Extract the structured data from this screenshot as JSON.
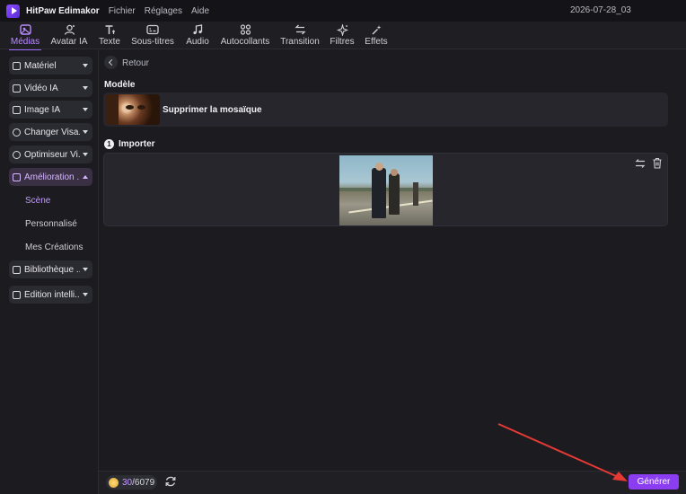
{
  "titlebar": {
    "app_name": "HitPaw Edimakor",
    "menu": [
      "Fichier",
      "Réglages",
      "Aide"
    ],
    "project_name": "2026-07-28_03"
  },
  "toolbar": {
    "tools": [
      {
        "label": "Médias",
        "icon": "media-icon",
        "active": true
      },
      {
        "label": "Avatar IA",
        "icon": "avatar-icon"
      },
      {
        "label": "Texte",
        "icon": "text-icon"
      },
      {
        "label": "Sous-titres",
        "icon": "subtitles-icon"
      },
      {
        "label": "Audio",
        "icon": "audio-icon"
      },
      {
        "label": "Autocollants",
        "icon": "stickers-icon"
      },
      {
        "label": "Transition",
        "icon": "transition-icon"
      },
      {
        "label": "Filtres",
        "icon": "filters-icon"
      },
      {
        "label": "Effets",
        "icon": "effects-icon"
      }
    ]
  },
  "sidebar": {
    "items": [
      {
        "label": "Matériel"
      },
      {
        "label": "Vidéo IA"
      },
      {
        "label": "Image IA"
      },
      {
        "label": "Changer Visa..."
      },
      {
        "label": "Optimiseur Vi..."
      },
      {
        "label": "Amélioration ...",
        "expanded": true
      },
      {
        "label": "Bibliothèque ..."
      },
      {
        "label": "Édition intelli..."
      }
    ],
    "subitems": [
      {
        "label": "Scène",
        "active": true
      },
      {
        "label": "Personnalisé"
      },
      {
        "label": "Mes Créations"
      }
    ]
  },
  "main": {
    "back_label": "Retour",
    "model_section_title": "Modèle",
    "model_name": "Supprimer la mosaïque",
    "import_step": "1",
    "import_title": "Importer"
  },
  "bottom": {
    "credits_used": "30",
    "credits_total": "/6079",
    "generate_label": "Générer"
  },
  "colors": {
    "accent": "#8b3df2",
    "active_text": "#b98cff",
    "annotation_arrow": "#e53935"
  }
}
